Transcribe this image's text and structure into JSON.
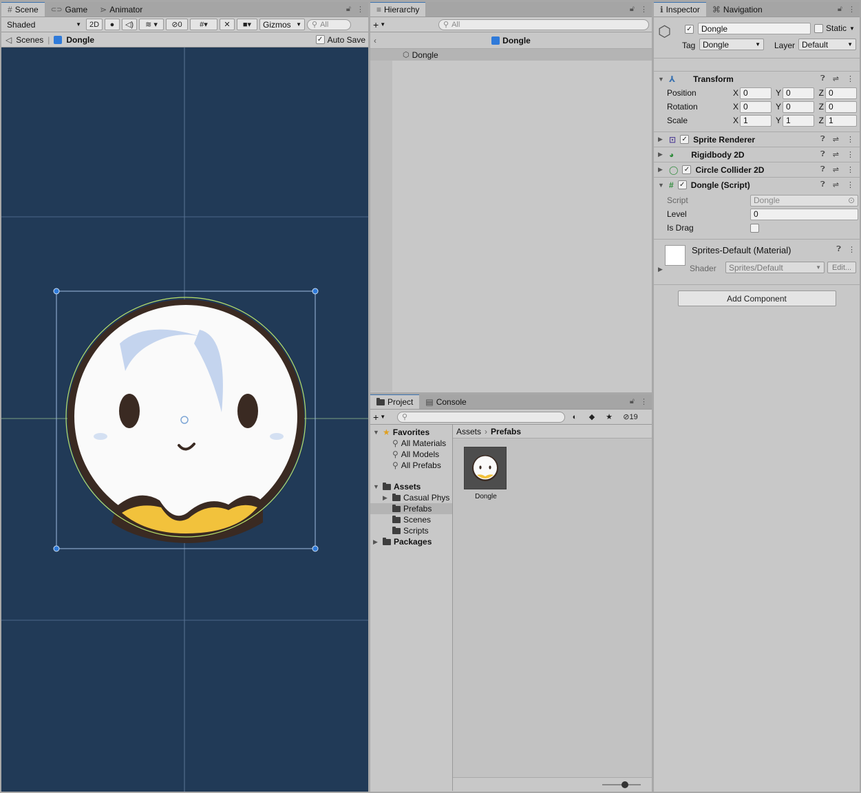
{
  "scene": {
    "tabs": [
      {
        "label": "Scene",
        "icon": "grid-icon"
      },
      {
        "label": "Game",
        "icon": "gamepad-icon"
      },
      {
        "label": "Animator",
        "icon": "animator-icon"
      }
    ],
    "shading_mode": "Shaded",
    "mode_2d": "2D",
    "hidden_count": "0",
    "gizmos_label": "Gizmos",
    "search_placeholder": "All",
    "breadcrumb_root": "Scenes",
    "breadcrumb_current": "Dongle",
    "auto_save_label": "Auto Save",
    "background_color": "#213a57"
  },
  "hierarchy": {
    "tab": "Hierarchy",
    "search_placeholder": "All",
    "context_title": "Dongle",
    "items": [
      {
        "label": "Dongle"
      }
    ]
  },
  "project": {
    "tabs": [
      {
        "label": "Project"
      },
      {
        "label": "Console"
      }
    ],
    "hidden_count": "19",
    "favorites": {
      "label": "Favorites",
      "items": [
        "All Materials",
        "All Models",
        "All Prefabs"
      ]
    },
    "assets": {
      "label": "Assets",
      "items": [
        "Casual Phys",
        "Prefabs",
        "Scenes",
        "Scripts"
      ]
    },
    "packages_label": "Packages",
    "breadcrumb": [
      "Assets",
      "Prefabs"
    ],
    "files": [
      {
        "label": "Dongle"
      }
    ]
  },
  "inspector": {
    "tabs": [
      {
        "label": "Inspector"
      },
      {
        "label": "Navigation"
      }
    ],
    "object_name": "Dongle",
    "static_label": "Static",
    "tag_label": "Tag",
    "tag_value": "Dongle",
    "layer_label": "Layer",
    "layer_value": "Default",
    "transform": {
      "title": "Transform",
      "rows": [
        {
          "label": "Position",
          "x": "0",
          "y": "0",
          "z": "0"
        },
        {
          "label": "Rotation",
          "x": "0",
          "y": "0",
          "z": "0"
        },
        {
          "label": "Scale",
          "x": "1",
          "y": "1",
          "z": "1"
        }
      ]
    },
    "components": [
      {
        "title": "Sprite Renderer",
        "icon": "sprite-renderer-icon",
        "has_checkbox": true
      },
      {
        "title": "Rigidbody 2D",
        "icon": "rigidbody-icon",
        "has_checkbox": false
      },
      {
        "title": "Circle Collider 2D",
        "icon": "circle-collider-icon",
        "has_checkbox": true
      }
    ],
    "script": {
      "title": "Dongle (Script)",
      "script_label": "Script",
      "script_value": "Dongle",
      "level_label": "Level",
      "level_value": "0",
      "is_drag_label": "Is Drag"
    },
    "material": {
      "name": "Sprites-Default (Material)",
      "shader_label": "Shader",
      "shader_value": "Sprites/Default",
      "edit_label": "Edit..."
    },
    "add_component_label": "Add Component",
    "axis_labels": [
      "X",
      "Y",
      "Z"
    ]
  },
  "colors": {
    "accent": "#3a72b0",
    "scene_bg": "#213a57",
    "selection_blue": "#2f7ad9",
    "collider_green": "#b8e06a"
  }
}
